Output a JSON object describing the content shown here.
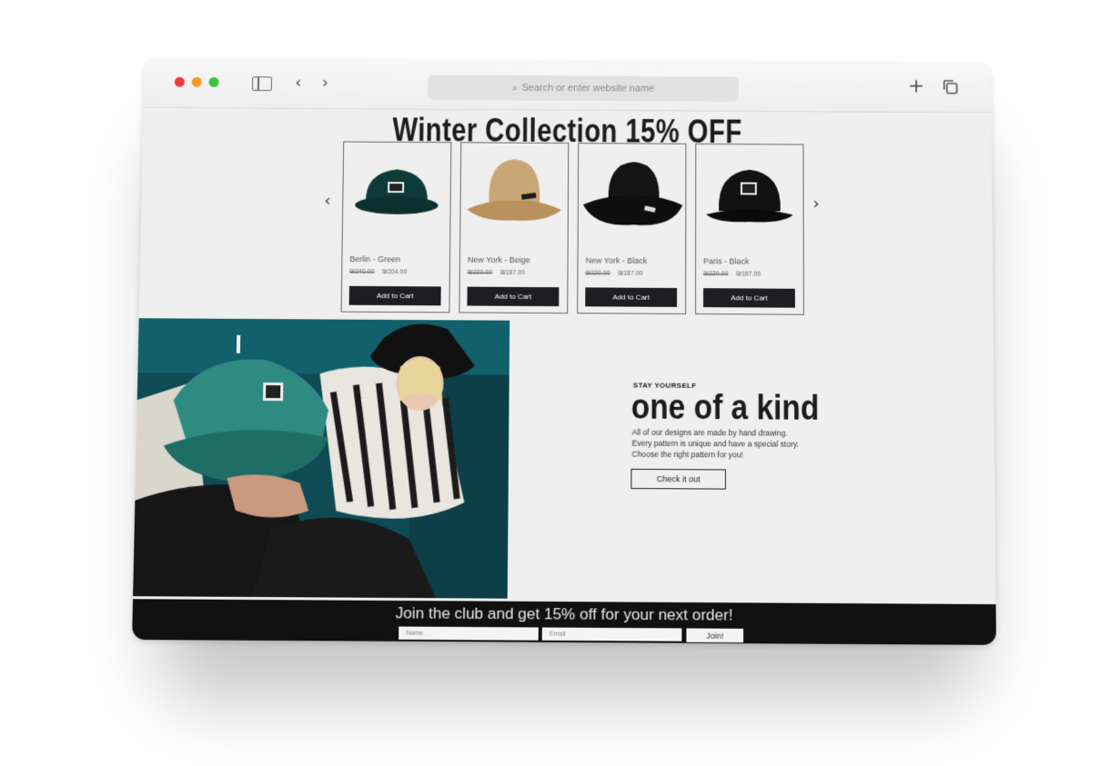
{
  "browser": {
    "address_placeholder": "Search or enter website name"
  },
  "promo": {
    "title": "Winter Collection 15% OFF"
  },
  "products": [
    {
      "name": "Berlin - Green",
      "old_price": "₪240.00",
      "price": "₪204.00",
      "button": "Add to Cart",
      "hat_color": "#0f3a3a"
    },
    {
      "name": "New York - Beige",
      "old_price": "₪220.00",
      "price": "₪187.00",
      "button": "Add to Cart",
      "hat_color": "#c9a675"
    },
    {
      "name": "New York - Black",
      "old_price": "₪220.00",
      "price": "₪187.00",
      "button": "Add to Cart",
      "hat_color": "#141414"
    },
    {
      "name": "Paris - Black",
      "old_price": "₪220.00",
      "price": "₪187.00",
      "button": "Add to Cart",
      "hat_color": "#121212"
    }
  ],
  "feature": {
    "eyebrow": "STAY YOURSELF",
    "heading": "one of a kind",
    "lines": [
      "All of our designs are made by hand drawing.",
      "Every pattern is unique and have a special story.",
      "Choose the right pattern for you!"
    ],
    "cta": "Check it out"
  },
  "club": {
    "title": "Join the club and get 15% off for your next order!",
    "name_placeholder": "Name",
    "email_placeholder": "Email",
    "join_label": "Join!"
  },
  "colors": {
    "page_bg": "#efefef",
    "dark": "#1d1d22",
    "footer_bg": "#111111"
  }
}
